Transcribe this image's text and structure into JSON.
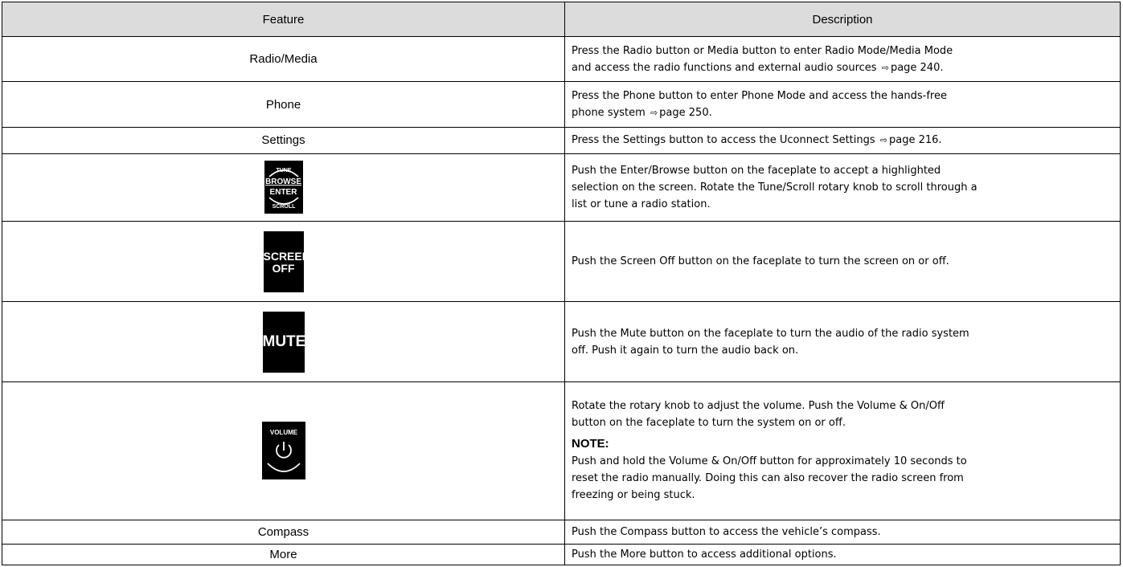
{
  "table": {
    "headers": {
      "feature": "Feature",
      "description": "Description"
    },
    "rows": {
      "radio_media": {
        "feature": "Radio/Media",
        "desc_line1": "Press the Radio button or Media button to enter Radio Mode/Media Mode",
        "desc_line2": "and access the radio functions and external audio sources",
        "page_ref": "page 240."
      },
      "phone": {
        "feature": "Phone",
        "desc_line1": "Press the Phone button to enter Phone Mode and access the hands-free",
        "desc_line2": "phone system",
        "page_ref": "page 250."
      },
      "settings": {
        "feature": "Settings",
        "desc_line1": "Press the Settings button to access the Uconnect Settings",
        "page_ref": "page 216."
      },
      "browse_enter": {
        "icon_text": {
          "top": "TUNE",
          "browse": "BROWSE",
          "enter": "ENTER",
          "bottom": "SCROLL"
        },
        "desc_line1": "Push the Enter/Browse button on the faceplate to accept a highlighted",
        "desc_line2": "selection on the screen. Rotate the Tune/Scroll rotary knob to scroll through a",
        "desc_line3": "list or tune a radio station."
      },
      "screen_off": {
        "icon_text_line1": "SCREEN",
        "icon_text_line2": "OFF",
        "desc": "Push the Screen Off button on the faceplate to turn the screen on or off."
      },
      "mute": {
        "icon_text": "MUTE",
        "desc_line1": "Push the Mute button on the faceplate to turn the audio of the radio system",
        "desc_line2": "off. Push it again to turn the audio back on."
      },
      "volume": {
        "icon_text": "VOLUME",
        "desc_line1": "Rotate the rotary knob to adjust the volume. Push the Volume & On/Off",
        "desc_line2": "button on the faceplate to turn the system on or off.",
        "note_label": "NOTE:",
        "note_line1": "Push and hold the Volume & On/Off button for approximately 10 seconds to",
        "note_line2": "reset the radio manually. Doing this can also recover the radio screen from",
        "note_line3": "freezing or being stuck."
      },
      "compass": {
        "feature": "Compass",
        "desc": "Push the Compass button to access the vehicle’s compass."
      },
      "more": {
        "feature": "More",
        "desc": "Push the More button to access additional options."
      }
    }
  },
  "icons": {
    "page_reference": "arrow-pointer-icon",
    "pointer_glyph": "⇨"
  }
}
